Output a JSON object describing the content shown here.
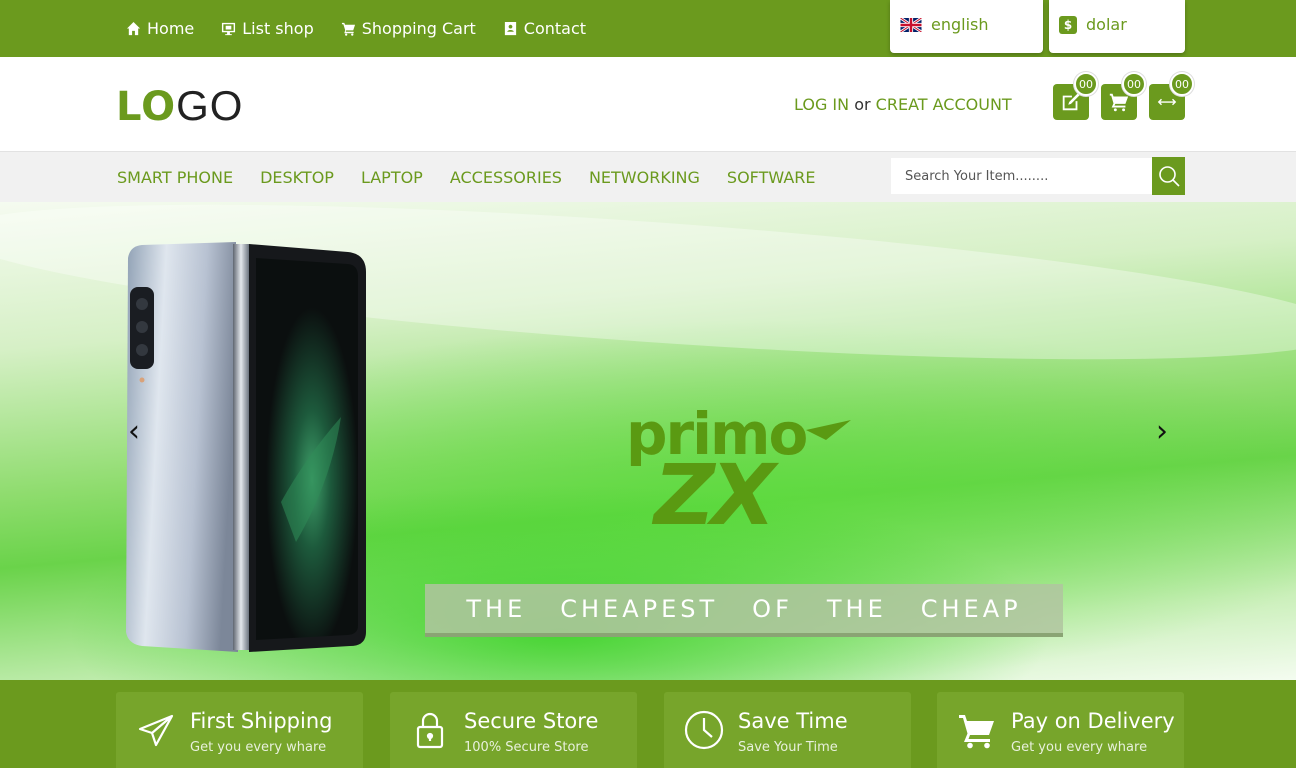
{
  "topnav": {
    "items": [
      {
        "label": "Home",
        "icon": "home-icon"
      },
      {
        "label": "List shop",
        "icon": "monitor-icon"
      },
      {
        "label": "Shopping Cart",
        "icon": "cart-icon"
      },
      {
        "label": "Contact",
        "icon": "contact-icon"
      }
    ],
    "language": {
      "value": "english",
      "icon": "uk-flag-icon"
    },
    "currency": {
      "value": "dolar",
      "icon": "dollar-icon"
    }
  },
  "header": {
    "logo": {
      "part1": "LO",
      "part2": "GO"
    },
    "login_label": "LOG IN",
    "or_label": "or",
    "register_label": "CREAT ACCOUNT",
    "icons": [
      {
        "name": "edit-icon",
        "badge": "00"
      },
      {
        "name": "cart-icon",
        "badge": "00"
      },
      {
        "name": "compare-icon",
        "badge": "00"
      }
    ]
  },
  "categories": [
    "SMART PHONE",
    "DESKTOP",
    "LAPTOP",
    "ACCESSORIES",
    "NETWORKING",
    "SOFTWARE"
  ],
  "search": {
    "placeholder": "Search Your Item........"
  },
  "banner": {
    "brand_line1": "primo",
    "brand_line2": "ZX",
    "tagline": [
      "THE",
      "CHEAPEST",
      "OF",
      "THE",
      "CHEAP"
    ],
    "prev": "‹",
    "next": "›"
  },
  "features": [
    {
      "title": "First Shipping",
      "subtitle": "Get you every whare",
      "icon": "paper-plane-icon"
    },
    {
      "title": "Secure Store",
      "subtitle": "100% Secure Store",
      "icon": "lock-icon"
    },
    {
      "title": "Save Time",
      "subtitle": "Save Your Time",
      "icon": "clock-icon"
    },
    {
      "title": "Pay on Delivery",
      "subtitle": "Get you every whare",
      "icon": "cart-icon"
    }
  ],
  "colors": {
    "primary": "#6b9a1e",
    "feature_box": "#77a52b",
    "nav_bg": "#f1f1f1"
  }
}
